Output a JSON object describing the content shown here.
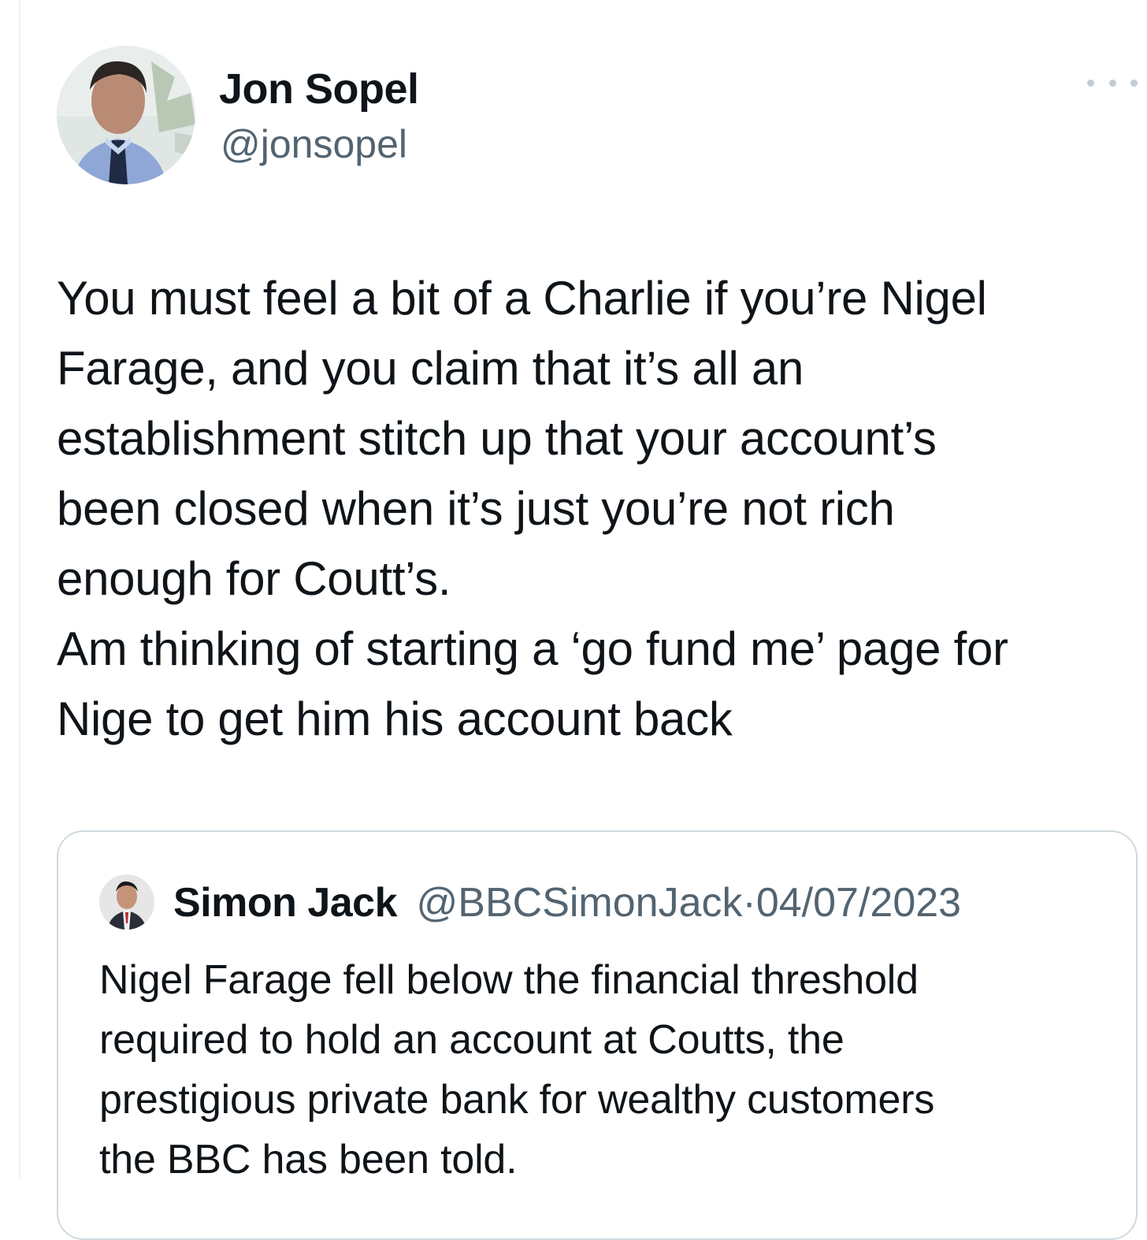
{
  "tweet": {
    "author": {
      "display_name": "Jon Sopel",
      "handle": "@jonsopel"
    },
    "text_lines": [
      "You must feel a bit of a Charlie if you’re Nigel",
      "Farage, and you claim that it’s all an",
      "establishment stitch up that your account’s",
      "been closed when it’s just you’re not rich",
      "enough for Coutt’s.",
      "Am thinking of starting a ‘go fund me’ page for",
      "Nige to get him his account back"
    ],
    "more_icon": "more-horizontal-icon"
  },
  "quoted_tweet": {
    "author": {
      "display_name": "Simon Jack",
      "handle": "@BBCSimonJack",
      "separator": "·",
      "date": "04/07/2023"
    },
    "text_lines": [
      "Nigel Farage fell below the financial threshold",
      "required to hold an account at Coutts, the",
      "prestigious private bank for wealthy customers",
      "the BBC has been told."
    ]
  },
  "colors": {
    "text_primary": "#0f1419",
    "text_secondary": "#536471",
    "border": "#cfd9de"
  }
}
